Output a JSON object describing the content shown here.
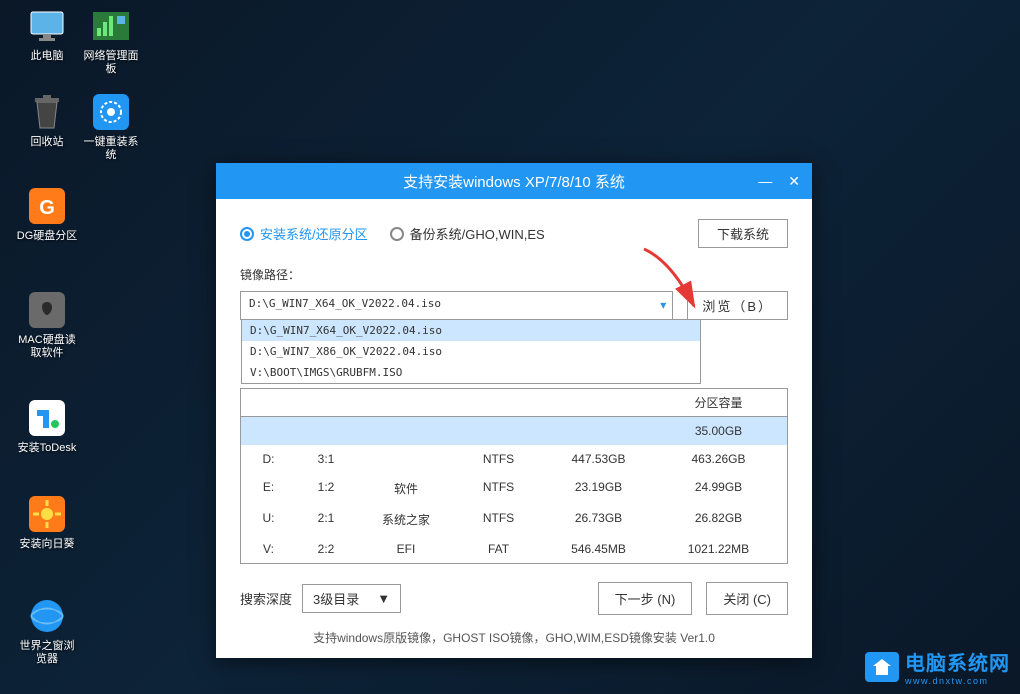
{
  "desktop": {
    "icons": [
      {
        "label": "此电脑"
      },
      {
        "label": "网络管理面板"
      },
      {
        "label": "回收站"
      },
      {
        "label": "一键重装系统"
      },
      {
        "label": "DG硬盘分区"
      },
      {
        "label": "MAC硬盘读取软件"
      },
      {
        "label": "安装ToDesk"
      },
      {
        "label": "安装向日葵"
      },
      {
        "label": "世界之窗浏览器"
      }
    ]
  },
  "dialog": {
    "title": "支持安装windows XP/7/8/10 系统",
    "radio1": "安装系统/还原分区",
    "radio2": "备份系统/GHO,WIN,ES",
    "download_btn": "下载系统",
    "path_label": "镜像路径：",
    "path_value": "D:\\G_WIN7_X64_OK_V2022.04.iso",
    "browse_btn": "浏览（B）",
    "dropdown": [
      "D:\\G_WIN7_X64_OK_V2022.04.iso",
      "D:\\G_WIN7_X86_OK_V2022.04.iso",
      "V:\\BOOT\\IMGS\\GRUBFM.ISO"
    ],
    "table": {
      "headers": [
        "",
        "",
        "",
        "",
        "",
        "分区容量"
      ],
      "rows": [
        {
          "drive": "",
          "num": "",
          "label": "",
          "fs": "",
          "used": "",
          "total": "35.00GB"
        },
        {
          "drive": "D:",
          "num": "3:1",
          "label": "",
          "fs": "NTFS",
          "used": "447.53GB",
          "total": "463.26GB"
        },
        {
          "drive": "E:",
          "num": "1:2",
          "label": "软件",
          "fs": "NTFS",
          "used": "23.19GB",
          "total": "24.99GB"
        },
        {
          "drive": "U:",
          "num": "2:1",
          "label": "系统之家",
          "fs": "NTFS",
          "used": "26.73GB",
          "total": "26.82GB"
        },
        {
          "drive": "V:",
          "num": "2:2",
          "label": "EFI",
          "fs": "FAT",
          "used": "546.45MB",
          "total": "1021.22MB"
        }
      ]
    },
    "search_label": "搜索深度",
    "search_value": "3级目录",
    "next_btn": "下一步 (N)",
    "close_btn": "关闭 (C)",
    "footer": "支持windows原版镜像，GHOST ISO镜像，GHO,WIM,ESD镜像安装 Ver1.0"
  },
  "watermark": {
    "zh": "电脑系统网",
    "url": "www.dnxtw.com"
  }
}
